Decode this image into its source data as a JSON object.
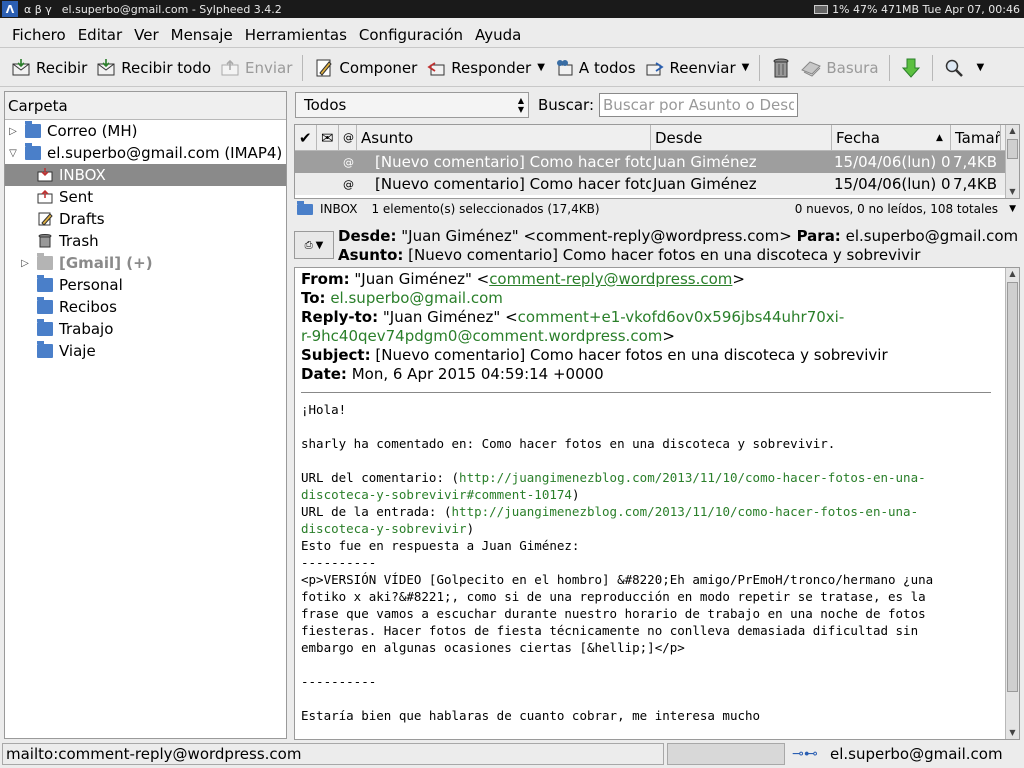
{
  "titlebar": {
    "left_icons": "α β γ",
    "title": "el.superbo@gmail.com - Sylpheed 3.4.2",
    "sys_status": "1% 47% 471MB Tue Apr 07, 00:46"
  },
  "menu": [
    "Fichero",
    "Editar",
    "Ver",
    "Mensaje",
    "Herramientas",
    "Configuración",
    "Ayuda"
  ],
  "toolbar": {
    "recibir": "Recibir",
    "recibir_todo": "Recibir todo",
    "enviar": "Enviar",
    "componer": "Componer",
    "responder": "Responder",
    "a_todos": "A todos",
    "reenviar": "Reenviar",
    "basura": "Basura"
  },
  "folders": {
    "header": "Carpeta",
    "items": [
      {
        "label": "Correo (MH)"
      },
      {
        "label": "el.superbo@gmail.com (IMAP4)"
      },
      {
        "label": "INBOX"
      },
      {
        "label": "Sent"
      },
      {
        "label": "Drafts"
      },
      {
        "label": "Trash"
      },
      {
        "label": "[Gmail] (+)"
      },
      {
        "label": "Personal"
      },
      {
        "label": "Recibos"
      },
      {
        "label": "Trabajo"
      },
      {
        "label": "Viaje"
      }
    ]
  },
  "filter": {
    "selected": "Todos",
    "search_label": "Buscar:",
    "search_placeholder": "Buscar por Asunto o Desde"
  },
  "msglist": {
    "columns": {
      "subject": "Asunto",
      "from": "Desde",
      "date": "Fecha",
      "size": "Tamaño"
    },
    "rows": [
      {
        "subject": "[Nuevo comentario] Como hacer fotos en una discoteca y sobrevivir",
        "from": "Juan Giménez",
        "date": "15/04/06(lun) 0",
        "size": "7,4KB"
      },
      {
        "subject": "[Nuevo comentario] Como hacer fotos en una discoteca y sobrevivir",
        "from": "Juan Giménez",
        "date": "15/04/06(lun) 0",
        "size": "7,4KB"
      }
    ]
  },
  "list_status": {
    "folder": "INBOX",
    "selection": "1 elemento(s) seleccionados (17,4KB)",
    "totals": "0 nuevos, 0 no leídos, 108 totales"
  },
  "summary": {
    "from_label": "Desde:",
    "from_value": "\"Juan Giménez\" <comment-reply@wordpress.com>",
    "to_label": "Para:",
    "to_value": "el.superbo@gmail.com",
    "subject_label": "Asunto:",
    "subject_value": "[Nuevo comentario] Como hacer fotos en una discoteca y sobrevivir"
  },
  "message": {
    "from_label": "From:",
    "from_name": "\"Juan Giménez\" <",
    "from_email": "comment-reply@wordpress.com",
    "from_close": ">",
    "to_label": "To:",
    "to_value": "el.superbo@gmail.com",
    "replyto_label": "Reply-to:",
    "replyto_name": "\"Juan Giménez\" <",
    "replyto_email_1": "comment+e1-vkofd6ov0x596jbs44uhr70xi-",
    "replyto_email_2": "r-9hc40qev74pdgm0@comment.wordpress.com",
    "replyto_close": ">",
    "subject_label": "Subject:",
    "subject_value": "[Nuevo comentario] Como hacer fotos en una discoteca y sobrevivir",
    "date_label": "Date:",
    "date_value": "Mon, 6 Apr 2015 04:59:14 +0000",
    "greeting": "¡Hola!",
    "commented": "sharly ha comentado en: Como hacer fotos en una discoteca y sobrevivir.",
    "url_comment_label": "URL del comentario: (",
    "url_comment_1": "http://juangimenezblog.com/2013/11/10/como-hacer-fotos-en-una-",
    "url_comment_2": "discoteca-y-sobrevivir#comment-10174",
    "url_entry_label": "URL de la entrada: (",
    "url_entry_1": "http://juangimenezblog.com/2013/11/10/como-hacer-fotos-en-una-",
    "url_entry_2": "discoteca-y-sobrevivir",
    "in_reply": "Esto fue en respuesta a Juan Giménez:",
    "dashes": "----------",
    "quote_1": "<p>VERSIÓN VÍDEO [Golpecito en el hombro] &#8220;Eh amigo/PrEmoH/tronco/hermano ¿una",
    "quote_2": "fotiko x aki?&#8221;, como si de una reproducción en modo repetir se tratase, es la",
    "quote_3": "frase que vamos a escuchar durante nuestro horario de trabajo en una noche de fotos",
    "quote_4": "fiesteras. Hacer fotos de fiesta técnicamente no conlleva demasiada dificultad sin",
    "quote_5": "embargo en algunas ocasiones ciertas [&hellip;]</p>",
    "closing": "Estaría bien que hablaras de cuanto cobrar, me interesa mucho"
  },
  "statusbar": {
    "left": "mailto:comment-reply@wordpress.com",
    "account": "el.superbo@gmail.com"
  }
}
